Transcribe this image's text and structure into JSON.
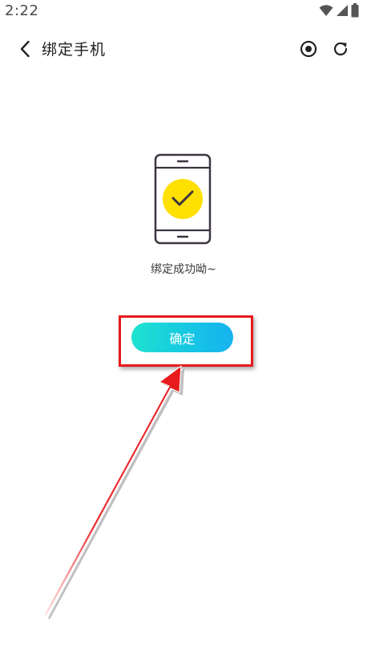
{
  "status_bar": {
    "time": "2:22",
    "icons": [
      "wifi-icon",
      "signal-icon",
      "battery-icon"
    ]
  },
  "app_bar": {
    "title": "绑定手机",
    "back_icon": "chevron-left-icon",
    "target_icon": "target-icon",
    "refresh_icon": "refresh-icon"
  },
  "illustration": {
    "icon": "phone-check-icon",
    "check_color": "#ffe000",
    "outline_color": "#3d3440"
  },
  "message": {
    "text": "绑定成功呦~"
  },
  "confirm": {
    "label": "确定",
    "gradient_start": "#1ee3cf",
    "gradient_end": "#17b2ef"
  },
  "annotation": {
    "color": "#e8191c"
  }
}
